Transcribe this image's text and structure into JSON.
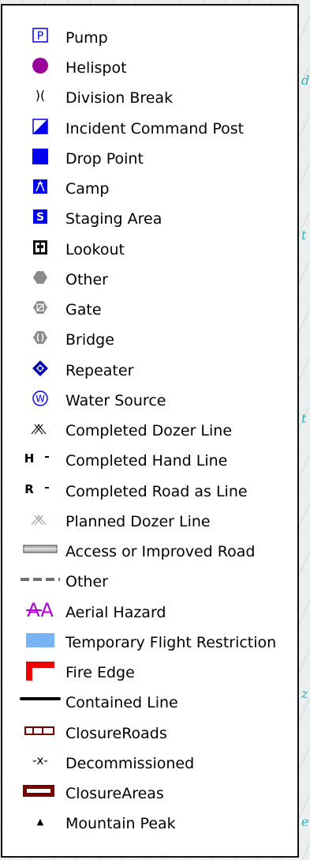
{
  "legend": {
    "items": [
      {
        "label": "Pump",
        "icon": "pump-icon",
        "glyph": "P"
      },
      {
        "label": "Helispot",
        "icon": "helispot-icon"
      },
      {
        "label": "Division Break",
        "icon": "division-break-icon",
        "glyph": ")("
      },
      {
        "label": "Incident Command Post",
        "icon": "incident-command-post-icon"
      },
      {
        "label": "Drop Point",
        "icon": "drop-point-icon"
      },
      {
        "label": "Camp",
        "icon": "camp-icon"
      },
      {
        "label": "Staging Area",
        "icon": "staging-area-icon",
        "glyph": "S"
      },
      {
        "label": "Lookout",
        "icon": "lookout-icon"
      },
      {
        "label": "Other",
        "icon": "other-point-icon"
      },
      {
        "label": "Gate",
        "icon": "gate-icon"
      },
      {
        "label": "Bridge",
        "icon": "bridge-icon"
      },
      {
        "label": "Repeater",
        "icon": "repeater-icon"
      },
      {
        "label": "Water Source",
        "icon": "water-source-icon",
        "glyph": "W"
      },
      {
        "label": "Completed Dozer Line",
        "icon": "completed-dozer-line-icon"
      },
      {
        "label": "Completed Hand Line",
        "icon": "completed-hand-line-icon",
        "glyph": "H"
      },
      {
        "label": "Completed Road as Line",
        "icon": "completed-road-as-line-icon",
        "glyph": "R"
      },
      {
        "label": "Planned Dozer Line",
        "icon": "planned-dozer-line-icon"
      },
      {
        "label": "Access or Improved Road",
        "icon": "access-road-icon"
      },
      {
        "label": "Other",
        "icon": "other-line-icon"
      },
      {
        "label": "Aerial Hazard",
        "icon": "aerial-hazard-icon",
        "glyph": "AA"
      },
      {
        "label": "Temporary Flight Restriction",
        "icon": "temporary-flight-restriction-icon"
      },
      {
        "label": "Fire Edge",
        "icon": "fire-edge-icon"
      },
      {
        "label": "Contained Line",
        "icon": "contained-line-icon"
      },
      {
        "label": "ClosureRoads",
        "icon": "closure-roads-icon"
      },
      {
        "label": "Decommissioned",
        "icon": "decommissioned-icon",
        "glyph": "-x-"
      },
      {
        "label": "ClosureAreas",
        "icon": "closure-areas-icon"
      },
      {
        "label": "Mountain Peak",
        "icon": "mountain-peak-icon",
        "glyph": "▲"
      }
    ]
  },
  "colors": {
    "blue": "#0000ee",
    "purple": "#990099",
    "gray": "#8a8a8a",
    "light_blue": "#78b4f4",
    "red": "#ee0000",
    "maroon": "#7a0000",
    "aerial_purple": "#b000e0",
    "map_teal": "#2fb0b7"
  }
}
